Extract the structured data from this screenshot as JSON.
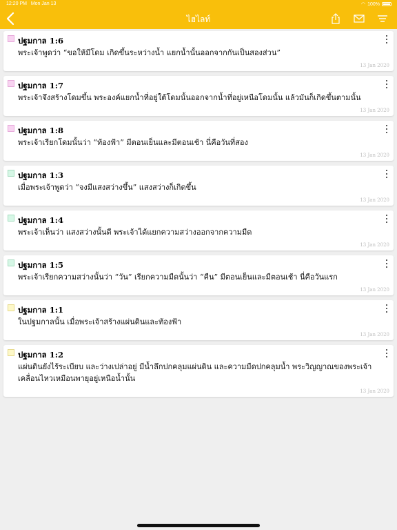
{
  "status": {
    "time": "12:20 PM",
    "date": "Mon Jan 13",
    "battery": "100%"
  },
  "header": {
    "title": "ไฮไลท์"
  },
  "colors": {
    "accent": "#f9bf0b",
    "pink": "#f8d3f1",
    "pink_border": "#e6a9d9",
    "green": "#d6f7e6",
    "green_border": "#a6dcbf",
    "yellow": "#fdf8c8",
    "yellow_border": "#e6d98a"
  },
  "highlights": [
    {
      "ref": "ปฐมกาล 1:6",
      "color": "pink",
      "text": "พระเจ้าพูดว่า “ขอให้มีโดม เกิดขึ้นระหว่างน้ำ แยกน้ำนั้นออกจากกันเป็นสองส่วน”",
      "date": "13 Jan 2020"
    },
    {
      "ref": "ปฐมกาล 1:7",
      "color": "pink",
      "text": "พระเจ้าจึงสร้างโดมขึ้น พระองค์แยกน้ำที่อยู่ใต้โดมนั้นออกจากน้ำที่อยู่เหนือโดมนั้น แล้วมันก็เกิดขึ้นตามนั้น",
      "date": "13 Jan 2020"
    },
    {
      "ref": "ปฐมกาล 1:8",
      "color": "pink",
      "text": "พระเจ้าเรียกโดมนั้นว่า “ท้องฟ้า” มีตอนเย็นและมีตอนเช้า นี่คือวันที่สอง",
      "date": "13 Jan 2020"
    },
    {
      "ref": "ปฐมกาล 1:3",
      "color": "green",
      "text": "เมื่อพระเจ้าพูดว่า “จงมีแสงสว่างขึ้น” แสงสว่างก็เกิดขึ้น",
      "date": "13 Jan 2020"
    },
    {
      "ref": "ปฐมกาล 1:4",
      "color": "green",
      "text": "พระเจ้าเห็นว่า แสงสว่างนั้นดี พระเจ้าได้แยกความสว่างออกจากความมืด",
      "date": "13 Jan 2020"
    },
    {
      "ref": "ปฐมกาล 1:5",
      "color": "green",
      "text": "พระเจ้าเรียกความสว่างนั้นว่า “วัน” เรียกความมืดนั้นว่า “คืน” มีตอนเย็นและมีตอนเช้า นี่คือวันแรก",
      "date": "13 Jan 2020"
    },
    {
      "ref": "ปฐมกาล 1:1",
      "color": "yellow",
      "text": "ในปฐมกาลนั้น เมื่อพระเจ้าสร้างแผ่นดินและท้องฟ้า",
      "date": "13 Jan 2020"
    },
    {
      "ref": "ปฐมกาล 1:2",
      "color": "yellow",
      "text": "แผ่นดินยังไร้ระเบียบ และว่างเปล่าอยู่ มีน้ำลึกปกคลุมแผ่นดิน และความมืดปกคลุมน้ำ พระวิญญาณของพระเจ้าเคลื่อนไหวเหมือนพายุอยู่เหนือน้ำนั้น",
      "date": "13 Jan 2020"
    }
  ]
}
